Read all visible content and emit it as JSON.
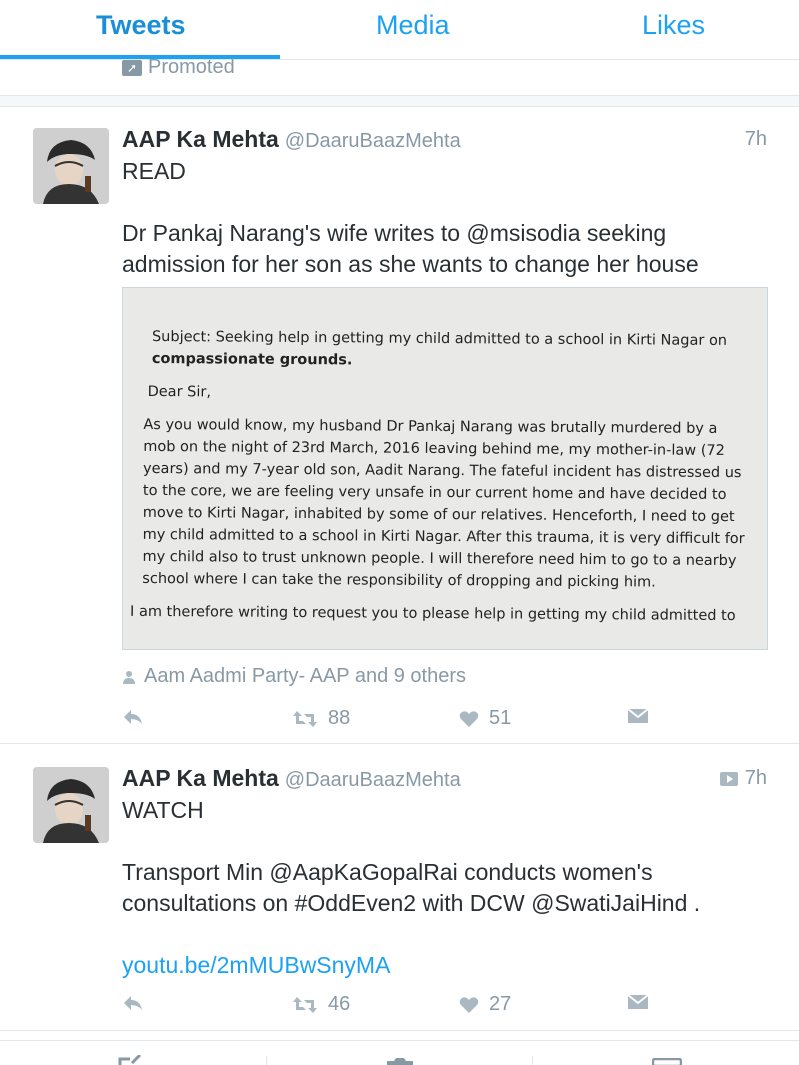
{
  "tabs": [
    {
      "label": "Tweets",
      "active": true
    },
    {
      "label": "Media",
      "active": false
    },
    {
      "label": "Likes",
      "active": false
    }
  ],
  "promoted_label": "Promoted",
  "tweets": [
    {
      "name": "AAP Ka Mehta",
      "handle": "@DaaruBaazMehta",
      "time": "7h",
      "text_line1": "READ",
      "text_line2": "Dr Pankaj Narang's wife writes to @msisodia seeking",
      "text_line3": "admission for her son as she wants to change her house",
      "letter": {
        "subject_prefix": "Subject: Seeking help in getting my child admitted to a school in Kirti Nagar on",
        "subject_bold": "compassionate grounds.",
        "salutation": "Dear Sir,",
        "body1": "As you would know, my husband Dr Pankaj Narang was brutally murdered by a mob on the night of 23rd March, 2016 leaving behind me, my mother-in-law (72 years) and my 7-year old son, Aadit Narang. The fateful incident has distressed us to the core, we are feeling very unsafe in our current home and have decided to move to Kirti Nagar, inhabited by some of our relatives. Henceforth, I need to get my child admitted to a school in Kirti Nagar. After this trauma, it is very difficult for my child also to trust unknown people. I will therefore need him to go to a nearby school where I can take the responsibility of dropping and picking him.",
        "body2": "I am therefore writing to request you to please help in getting my child admitted to"
      },
      "social_context": "Aam Aadmi Party- AAP and 9 others",
      "retweets": "88",
      "likes": "51"
    },
    {
      "name": "AAP Ka Mehta",
      "handle": "@DaaruBaazMehta",
      "time": "7h",
      "text_line1": "WATCH",
      "text_line2": "Transport Min @AapKaGopalRai conducts women's",
      "text_line3": "consultations on #OddEven2 with DCW @SwatiJaiHind .",
      "link": "youtu.be/2mMUBwSnyMA",
      "retweets": "46",
      "likes": "27"
    }
  ],
  "colors": {
    "accent": "#1da1f2",
    "muted": "#8899a6",
    "text": "#292f33",
    "border": "#e1e8ed"
  }
}
